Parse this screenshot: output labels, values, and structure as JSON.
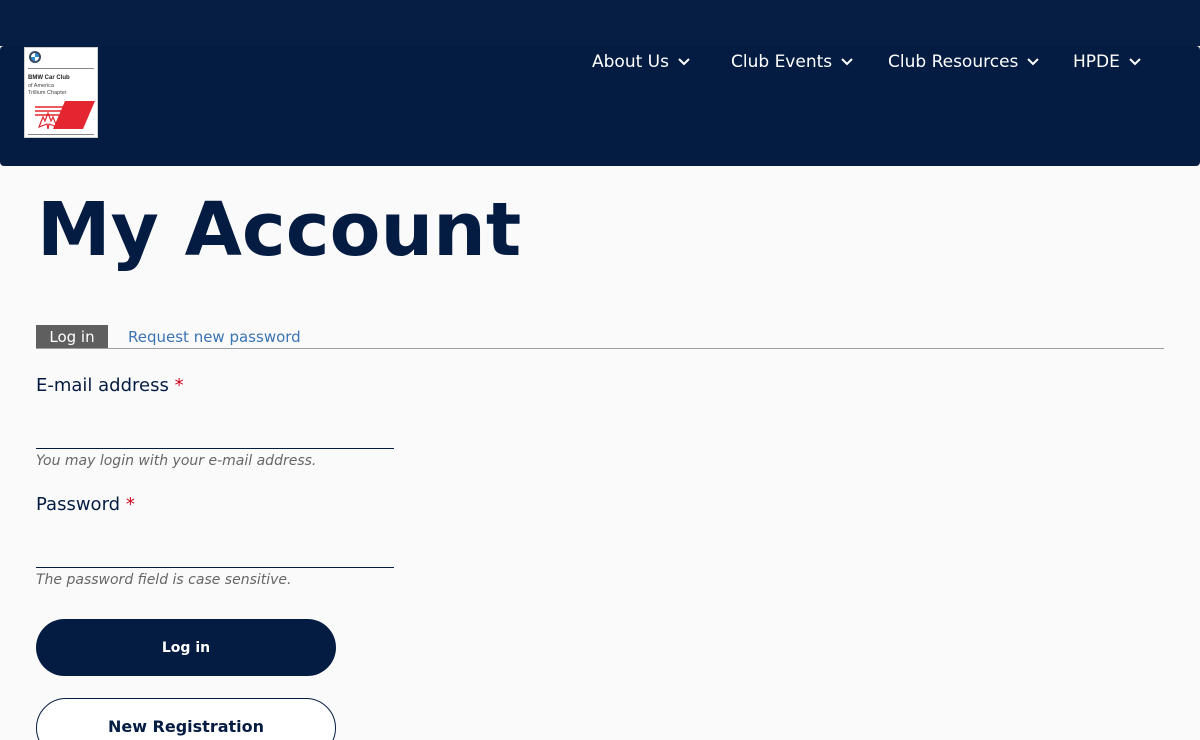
{
  "brand": {
    "logo_line1": "BMW Car Club",
    "logo_line2": "of America",
    "logo_line3": "Trillium Chapter",
    "colors": {
      "navy": "#051c42",
      "red": "#e3262f",
      "link": "#3b73b3"
    }
  },
  "nav": {
    "items": [
      {
        "label": "About Us",
        "icon": "chevron-down-icon"
      },
      {
        "label": "Club Events",
        "icon": "chevron-down-icon"
      },
      {
        "label": "Club Resources",
        "icon": "chevron-down-icon"
      },
      {
        "label": "HPDE",
        "icon": "chevron-down-icon"
      }
    ]
  },
  "page": {
    "title": "My Account"
  },
  "tabs": {
    "active": "Log in",
    "other": "Request new password"
  },
  "form": {
    "email": {
      "label": "E-mail address",
      "required_mark": "*",
      "value": "",
      "help": "You may login with your e-mail address."
    },
    "password": {
      "label": "Password",
      "required_mark": "*",
      "value": "",
      "help": "The password field is case sensitive."
    },
    "submit_label": "Log in",
    "register_label": "New Registration"
  }
}
